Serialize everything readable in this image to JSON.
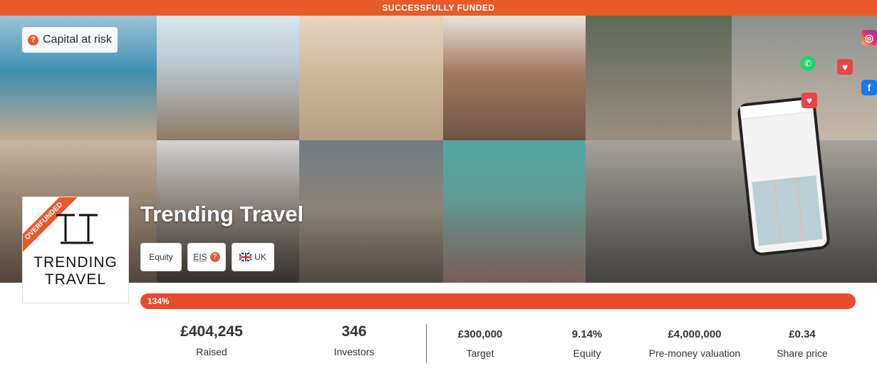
{
  "banner": {
    "text": "SUCCESSFULLY FUNDED"
  },
  "hero": {
    "risk_label": "Capital at risk",
    "social_icons": [
      "instagram-icon",
      "facebook-icon",
      "whatsapp-icon",
      "heart-icon"
    ]
  },
  "logo": {
    "ribbon": "OVERFUNDED",
    "wordmark_line1": "TRENDING",
    "wordmark_line2": "TRAVEL"
  },
  "company": {
    "name": "Trending Travel"
  },
  "tags": {
    "equity": "Equity",
    "eis": "EIS",
    "country": "UK"
  },
  "progress": {
    "label": "134%",
    "fraction": 1.0
  },
  "stats": {
    "raised_value": "£404,245",
    "raised_label": "Raised",
    "investors_value": "346",
    "investors_label": "Investors",
    "target_value": "£300,000",
    "target_label": "Target",
    "equity_value": "9.14%",
    "equity_label": "Equity",
    "valuation_value": "£4,000,000",
    "valuation_label": "Pre-money valuation",
    "share_value": "£0.34",
    "share_label": "Share price"
  },
  "colors": {
    "accent": "#e95a2b",
    "progress": "#e94b2c"
  }
}
